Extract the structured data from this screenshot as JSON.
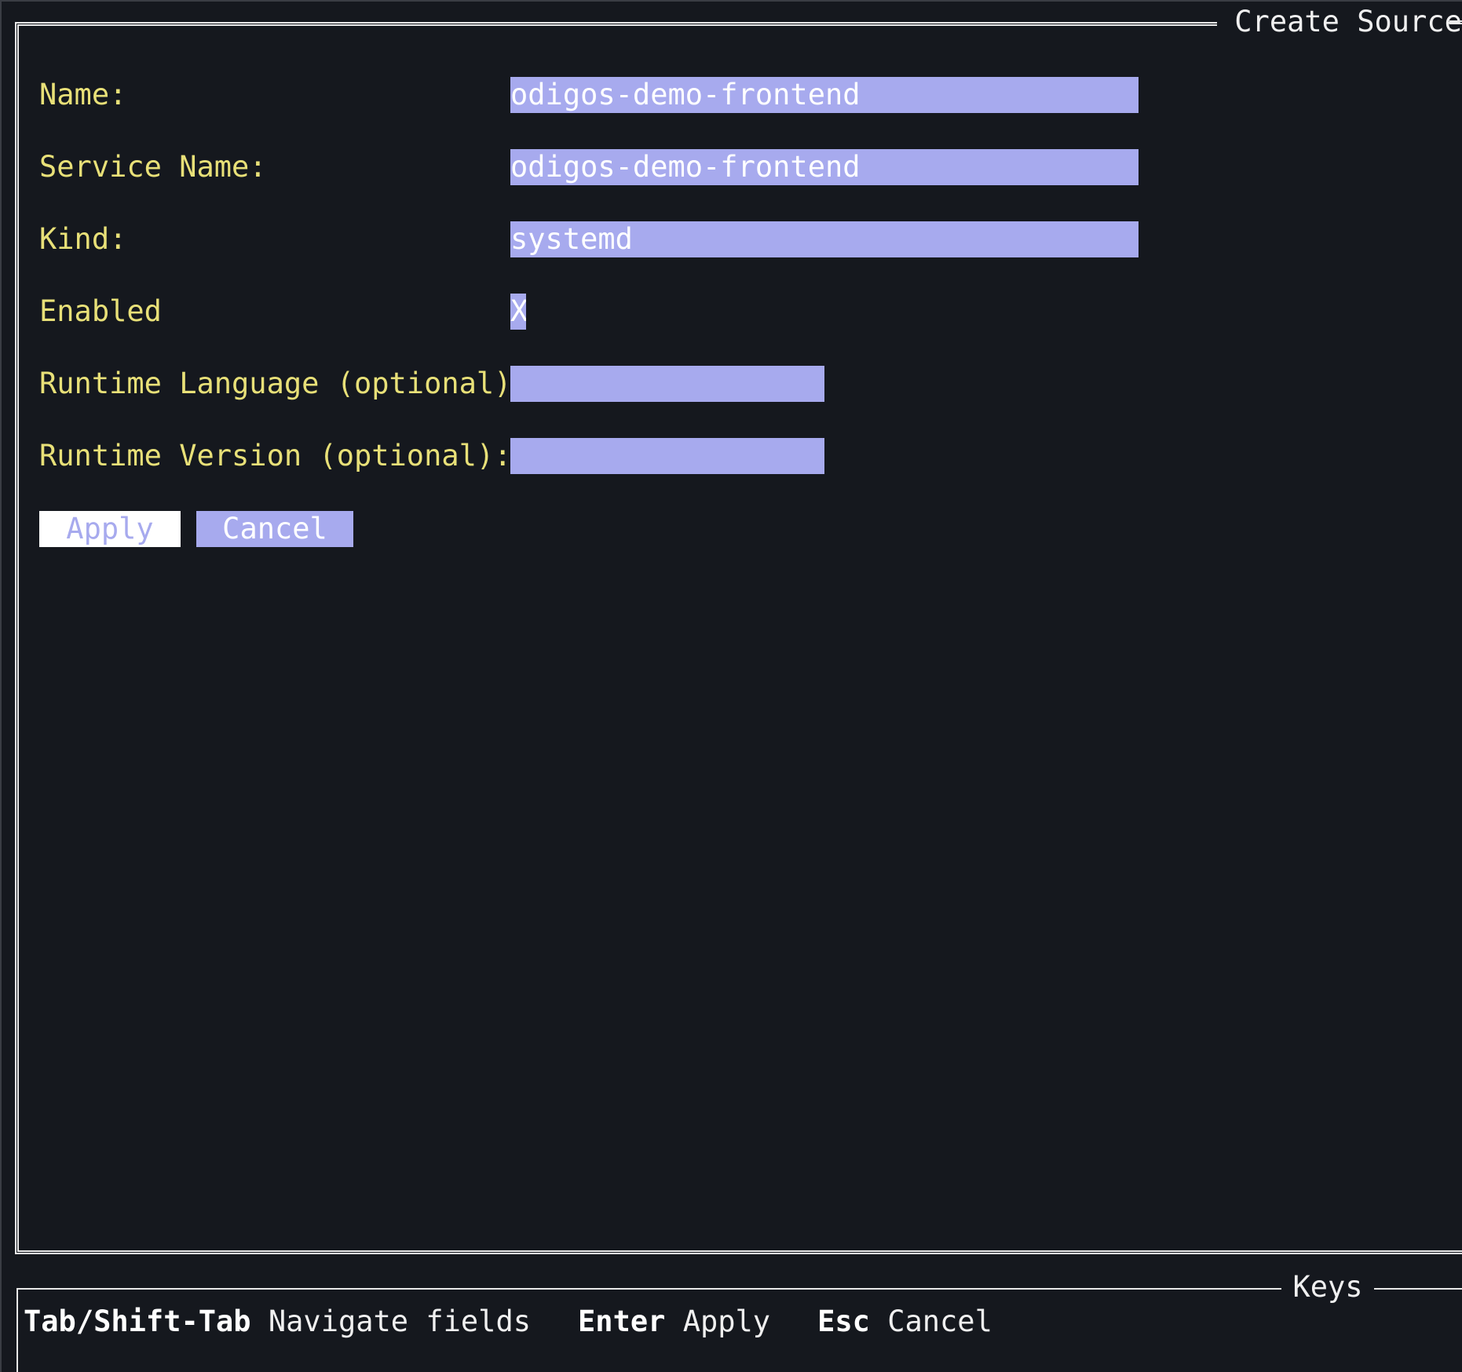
{
  "panel": {
    "title": "Create Source",
    "fields": [
      {
        "label": "Name:",
        "value": ""
      },
      {
        "label": "Service Name:",
        "value": ""
      },
      {
        "label": "Kind:",
        "value": ""
      },
      {
        "label": "Enabled",
        "value": "X"
      },
      {
        "label": "Runtime Language (optional):",
        "value": ""
      },
      {
        "label": "Runtime Version (optional):",
        "value": ""
      }
    ],
    "name_value": "odigos-demo-frontend",
    "service_name_value": "odigos-demo-frontend",
    "kind_value": "systemd",
    "buttons": {
      "apply": "Apply",
      "cancel": "Cancel"
    }
  },
  "keys": {
    "title": "Keys",
    "items": [
      {
        "key": "Tab/Shift-Tab",
        "desc": "Navigate fields"
      },
      {
        "key": "Enter",
        "desc": "Apply"
      },
      {
        "key": "Esc",
        "desc": "Cancel"
      }
    ]
  },
  "colors": {
    "background": "#15181e",
    "label": "#e8e078",
    "input_bg": "#a7aaee",
    "text": "#ffffff"
  }
}
